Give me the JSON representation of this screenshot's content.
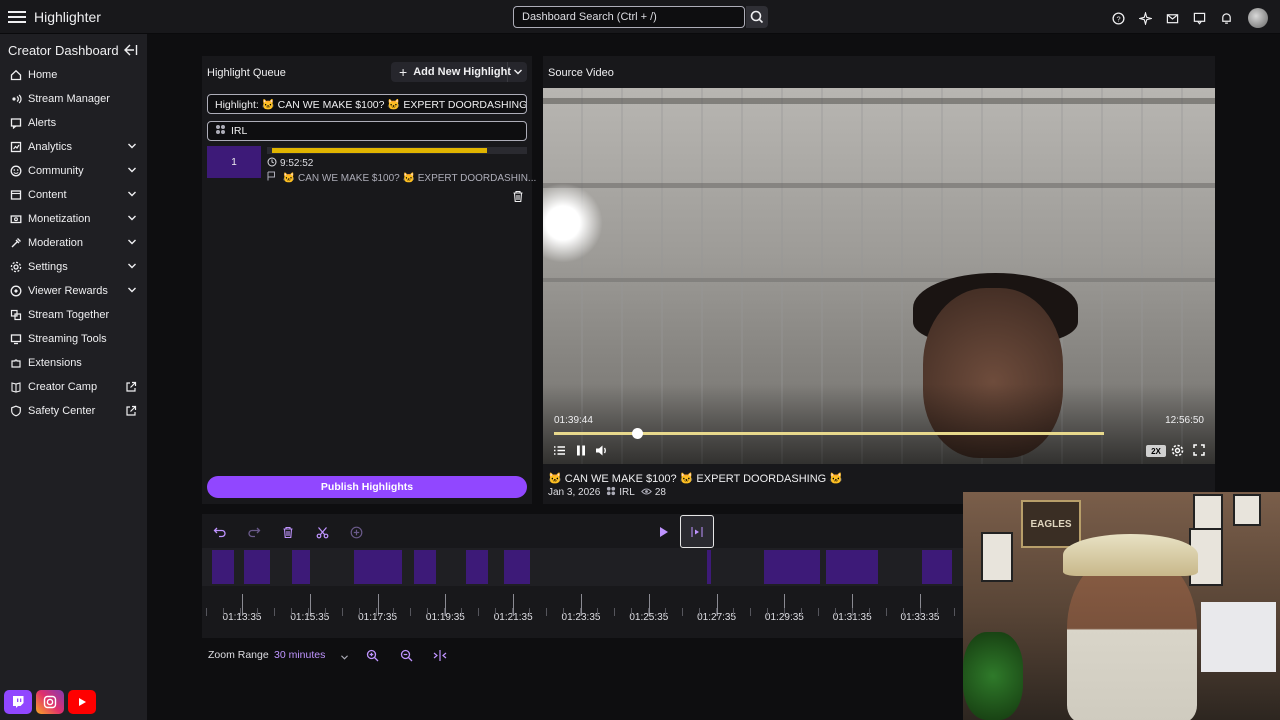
{
  "app": {
    "title": "Highlighter"
  },
  "search": {
    "placeholder": "Dashboard Search (Ctrl + /)"
  },
  "sidebar": {
    "title": "Creator Dashboard",
    "items": [
      {
        "label": "Home",
        "icon": "home-icon"
      },
      {
        "label": "Stream Manager",
        "icon": "stream-manager-icon"
      },
      {
        "label": "Alerts",
        "icon": "alerts-icon"
      },
      {
        "label": "Analytics",
        "icon": "analytics-icon"
      },
      {
        "label": "Community",
        "icon": "community-icon"
      },
      {
        "label": "Content",
        "icon": "content-icon"
      },
      {
        "label": "Monetization",
        "icon": "monetization-icon"
      },
      {
        "label": "Moderation",
        "icon": "moderation-icon"
      },
      {
        "label": "Settings",
        "icon": "settings-icon"
      },
      {
        "label": "Viewer Rewards",
        "icon": "viewer-rewards-icon"
      },
      {
        "label": "Stream Together",
        "icon": "stream-together-icon"
      },
      {
        "label": "Streaming Tools",
        "icon": "streaming-tools-icon"
      },
      {
        "label": "Extensions",
        "icon": "extensions-icon"
      },
      {
        "label": "Creator Camp",
        "icon": "creator-camp-icon"
      },
      {
        "label": "Safety Center",
        "icon": "safety-center-icon"
      }
    ]
  },
  "queue": {
    "header": "Highlight Queue",
    "add_label": "Add New Highlight",
    "title_value": "Highlight: 🐱 CAN WE MAKE $100? 🐱 EXPERT DOORDASHING 🐱",
    "category_value": "IRL",
    "clip": {
      "number": "1",
      "duration": "9:52:52",
      "name": "🐱 CAN WE MAKE $100? 🐱 EXPERT DOORDASHIN...",
      "bar_fill": 0.85
    },
    "publish_label": "Publish Highlights"
  },
  "video": {
    "header": "Source Video",
    "time_current": "01:39:44",
    "time_total": "12:56:50",
    "progress_knob": 0.15,
    "progress_buffered": 1.0,
    "speed": "2X",
    "title": "🐱 CAN WE MAKE $100? 🐱 EXPERT DOORDASHING 🐱",
    "date": "Jan 3, 2026",
    "category": "IRL",
    "views": "28"
  },
  "timeline": {
    "ticks": [
      "01:13:35",
      "01:15:35",
      "01:17:35",
      "01:19:35",
      "01:21:35",
      "01:23:35",
      "01:25:35",
      "01:27:35",
      "01:29:35",
      "01:31:35",
      "01:33:35"
    ],
    "zoom_label": "Zoom Range",
    "zoom_value": "30 minutes"
  },
  "webcam": {
    "sign_text": "EAGLES"
  },
  "colors": {
    "accent": "#9147ff",
    "clip_purple": "#3d1a78",
    "bar_yellow": "#e0b400"
  }
}
